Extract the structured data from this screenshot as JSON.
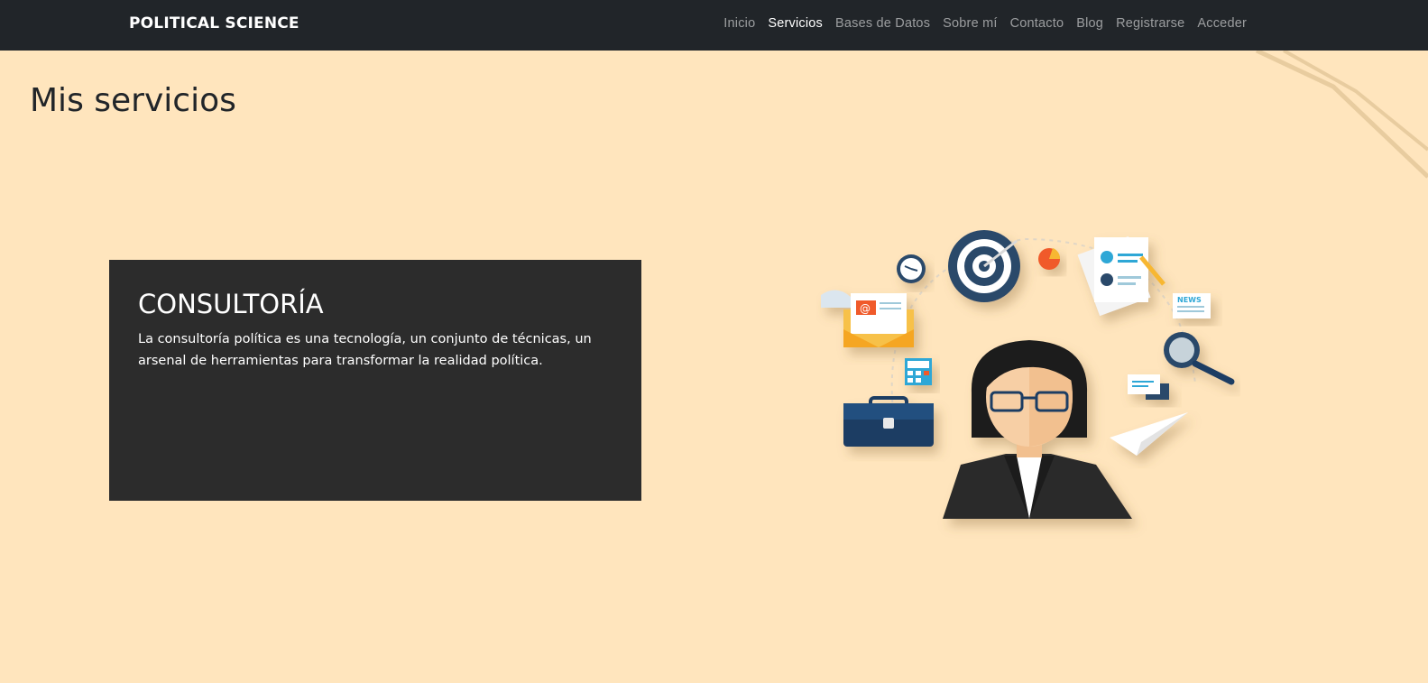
{
  "navbar": {
    "brand": "POLITICAL SCIENCE",
    "items": [
      {
        "label": "Inicio"
      },
      {
        "label": "Servicios",
        "active": true
      },
      {
        "label": "Bases de Datos"
      },
      {
        "label": "Sobre mí"
      },
      {
        "label": "Contacto"
      },
      {
        "label": "Blog"
      },
      {
        "label": "Registrarse"
      },
      {
        "label": "Acceder"
      }
    ]
  },
  "page": {
    "title": "Mis servicios"
  },
  "service_card": {
    "title": "CONSULTORÍA",
    "text": "La consultoría política es una tecnología, un conjunto de técnicas, un arsenal de herramientas para transformar la realidad política."
  },
  "illustration": {
    "news_label": "NEWS",
    "email_symbol": "@"
  },
  "colors": {
    "background": "#ffe5bd",
    "navbar": "#212529",
    "card": "#2c2c2c"
  }
}
